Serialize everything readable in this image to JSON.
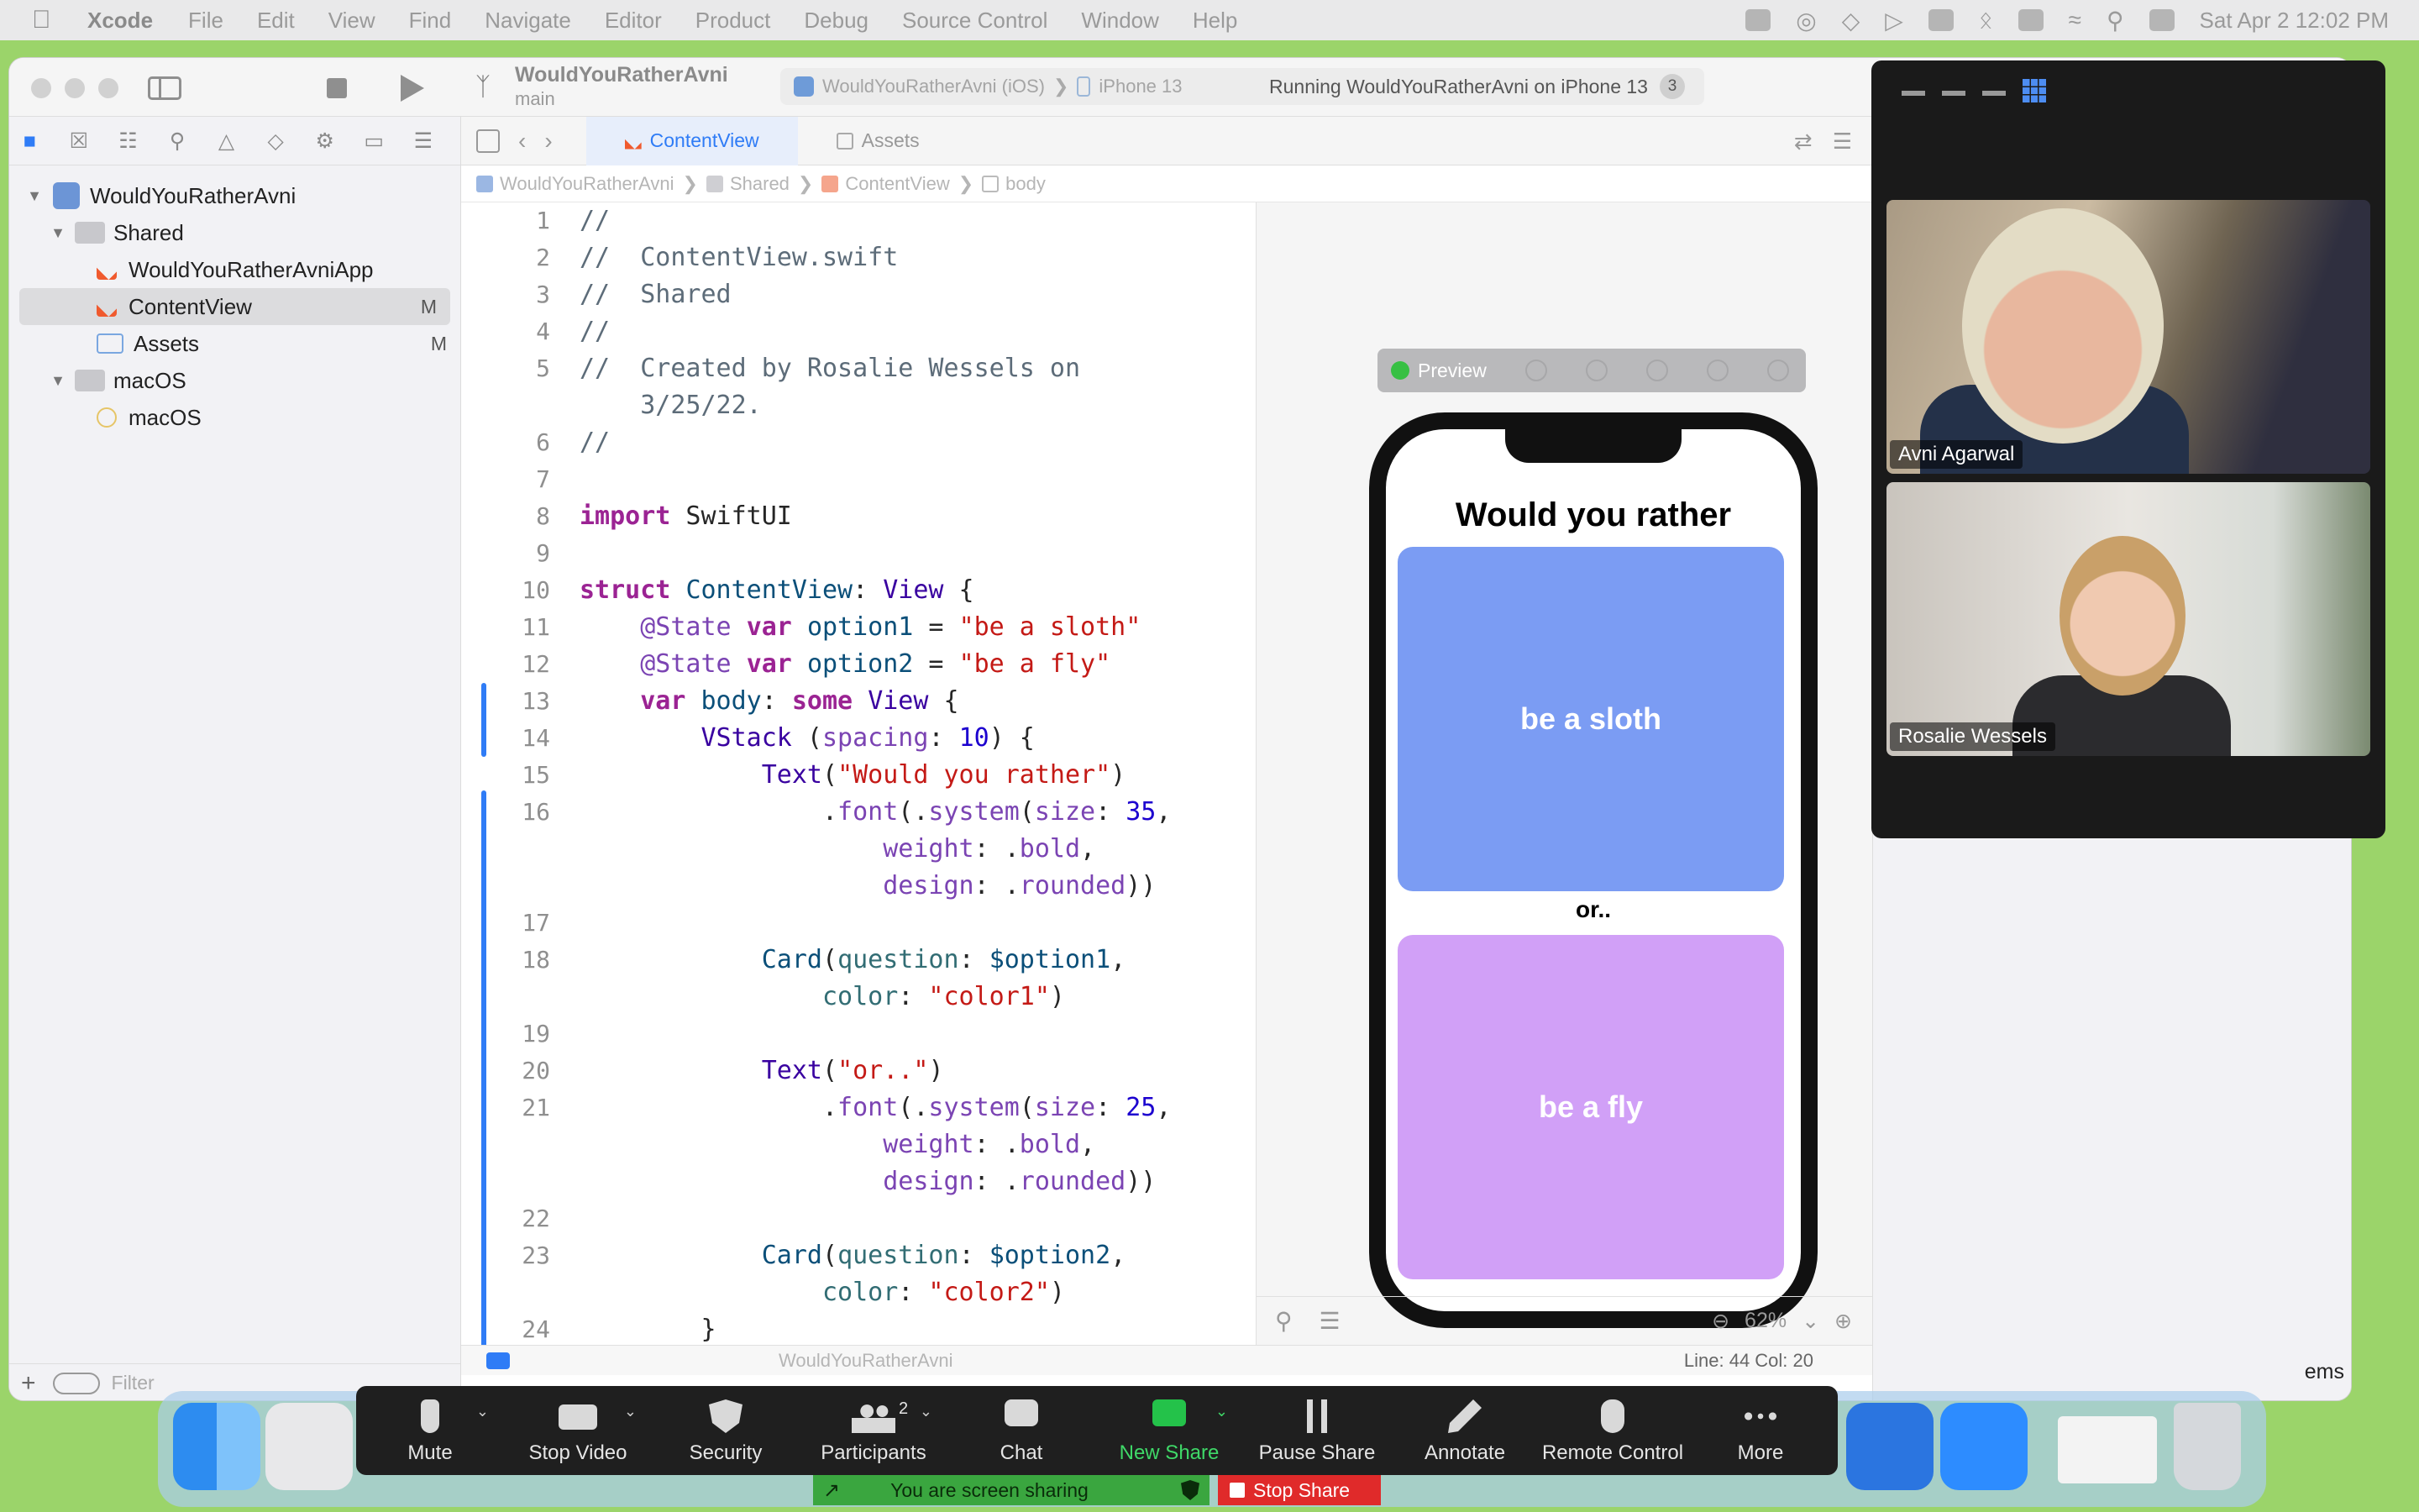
{
  "menubar": {
    "app_name": "Xcode",
    "items": [
      "File",
      "Edit",
      "View",
      "Find",
      "Navigate",
      "Editor",
      "Product",
      "Debug",
      "Source Control",
      "Window",
      "Help"
    ],
    "datetime": "Sat Apr 2  12:02 PM"
  },
  "toolbar": {
    "project_title": "WouldYouRatherAvni",
    "branch": "main",
    "scheme": "WouldYouRatherAvni (iOS)",
    "device": "iPhone 13",
    "run_status": "Running WouldYouRatherAvni on iPhone 13",
    "badge_count": "3"
  },
  "navigator": {
    "items": [
      {
        "label": "WouldYouRatherAvni",
        "badge": ""
      },
      {
        "label": "Shared",
        "badge": ""
      },
      {
        "label": "WouldYouRatherAvniApp",
        "badge": ""
      },
      {
        "label": "ContentView",
        "badge": "M"
      },
      {
        "label": "Assets",
        "badge": "M"
      },
      {
        "label": "macOS",
        "badge": ""
      },
      {
        "label": "macOS",
        "badge": ""
      }
    ],
    "filter_placeholder": "Filter"
  },
  "editor": {
    "tabs": [
      {
        "label": "ContentView"
      },
      {
        "label": "Assets"
      }
    ],
    "breadcrumbs": [
      "WouldYouRatherAvni",
      "Shared",
      "ContentView",
      "body"
    ],
    "line_numbers": [
      "1",
      "2",
      "3",
      "4",
      "5",
      "",
      "6",
      "7",
      "8",
      "9",
      "10",
      "11",
      "12",
      "13",
      "14",
      "15",
      "16",
      "",
      "",
      "17",
      "18",
      "",
      "19",
      "20",
      "21",
      "",
      "",
      "22",
      "23",
      "",
      "24"
    ]
  },
  "preview": {
    "toolbar_label": "Preview",
    "title": "Would you rather",
    "option1": "be a sloth",
    "separator": "or..",
    "option2": "be a fly",
    "zoom": "62%",
    "colors": {
      "card1": "#7b9cf3",
      "card2": "#d1a0f7"
    }
  },
  "status": {
    "line_col": "Line: 44  Col: 20",
    "target": "WouldYouRatherAvni"
  },
  "inspector": {
    "partial_text": "ems"
  },
  "zoom_panel": {
    "participants": [
      {
        "name": "Avni Agarwal"
      },
      {
        "name": "Rosalie Wessels"
      }
    ]
  },
  "meeting_controls": {
    "items": [
      {
        "label": "Mute"
      },
      {
        "label": "Stop Video"
      },
      {
        "label": "Security"
      },
      {
        "label": "Participants",
        "count": "2"
      },
      {
        "label": "Chat"
      },
      {
        "label": "New Share"
      },
      {
        "label": "Pause Share"
      },
      {
        "label": "Annotate"
      },
      {
        "label": "Remote Control"
      },
      {
        "label": "More"
      }
    ],
    "sharing_text": "You are screen sharing",
    "stop_share": "Stop Share"
  }
}
